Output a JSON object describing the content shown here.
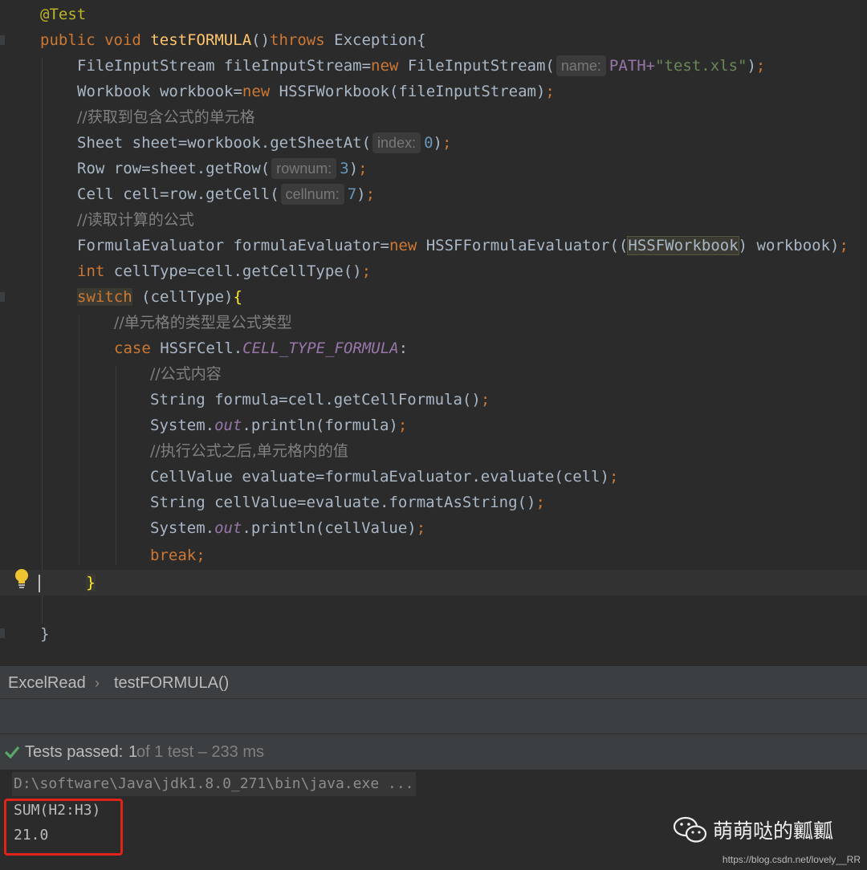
{
  "editor": {
    "l1": {
      "ann": "@Test"
    },
    "l2": {
      "kw1": "public",
      "kw2": "void",
      "fn": "testFORMULA",
      "p": "()",
      "kw3": "throws",
      "rest": " Exception{"
    },
    "l3": {
      "a": "FileInputStream fileInputStream=",
      "kw": "new",
      "b": " FileInputStream(",
      "hint": "name:",
      "c": "PATH+",
      "str": "\"test.xls\"",
      "d": ")",
      "semi": ";"
    },
    "l4": {
      "a": "Workbook workbook=",
      "kw": "new",
      "b": " HSSFWorkbook(fileInputStream)",
      "semi": ";"
    },
    "l5": {
      "cm": "//获取到包含公式的单元格"
    },
    "l6": {
      "a": "Sheet sheet=workbook.getSheetAt(",
      "hint": "index:",
      "num": "0",
      "b": ")",
      "semi": ";"
    },
    "l7": {
      "a": "Row row=sheet.getRow(",
      "hint": "rownum:",
      "num": "3",
      "b": ")",
      "semi": ";"
    },
    "l8": {
      "a": "Cell cell=row.getCell(",
      "hint": "cellnum:",
      "num": "7",
      "b": ")",
      "semi": ";"
    },
    "l9": {
      "cm": "//读取计算的公式"
    },
    "l10": {
      "a": "FormulaEvaluator formulaEvaluator=",
      "kw": "new",
      "b": " HSSFFormulaEvaluator((",
      "hl": "HSSFWorkbook",
      "c": ") workbook)",
      "semi": ";"
    },
    "l11": {
      "kw": "int",
      "a": " cellType=cell.getCellType()",
      "semi": ";"
    },
    "l12": {
      "kw": "switch",
      "a": " (cellType)",
      "brace": "{"
    },
    "l13": {
      "cm": "//单元格的类型是公式类型"
    },
    "l14": {
      "kw": "case",
      "a": " HSSFCell.",
      "st": "CELL_TYPE_FORMULA",
      "b": ":"
    },
    "l15": {
      "cm": "//公式内容"
    },
    "l16": {
      "a": "String formula=cell.getCellFormula()",
      "semi": ";"
    },
    "l17": {
      "a": "System.",
      "st": "out",
      "b": ".println(formula)",
      "semi": ";"
    },
    "l18": {
      "cm": "//执行公式之后,单元格内的值"
    },
    "l19": {
      "a": "CellValue evaluate=formulaEvaluator.evaluate(cell)",
      "semi": ";"
    },
    "l20": {
      "a": "String cellValue=evaluate.formatAsString()",
      "semi": ";"
    },
    "l21": {
      "a": "System.",
      "st": "out",
      "b": ".println(cellValue)",
      "semi": ";"
    },
    "l22": {
      "kw": "break",
      "semi": ";"
    },
    "l23": {
      "brace": "}"
    },
    "l25": {
      "a": "}"
    }
  },
  "breadcrumb": {
    "cls": "ExcelRead",
    "sep": "›",
    "method": "testFORMULA()"
  },
  "status": {
    "prefix": "Tests passed: ",
    "passed": "1",
    "suffix": " of 1 test – 233 ms"
  },
  "console": {
    "cmd": "D:\\software\\Java\\jdk1.8.0_271\\bin\\java.exe ...",
    "out1": "SUM(H2:H3)",
    "out2": "21.0"
  },
  "watermark": {
    "text": "萌萌哒的瓤瓤",
    "url": "https://blog.csdn.net/lovely__RR"
  },
  "icons": {
    "bulb": "lightbulb-icon",
    "check": "check-icon",
    "wechat": "wechat-icon"
  },
  "colors": {
    "keyword": "#cc7832",
    "function": "#ffc66d",
    "string": "#6a8759",
    "number": "#6897bb",
    "static": "#9876aa",
    "comment": "#808080",
    "pass": "#59a869",
    "highlight": "#e2231a"
  }
}
